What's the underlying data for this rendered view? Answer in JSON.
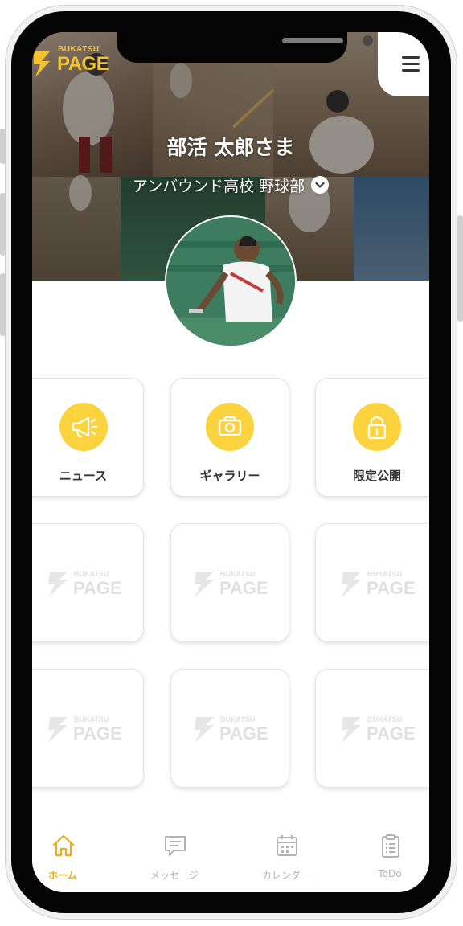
{
  "brand": {
    "logo_small": "BUKATSU",
    "logo_big": "PAGE",
    "accent_color": "#fbd33f",
    "brand_color": "#f2c230"
  },
  "header": {
    "user_name": "部活 太郎さま",
    "team_name": "アンバウンド高校 野球部",
    "team_dropdown_icon": "chevron-down-icon",
    "menu_icon": "hamburger-menu-icon"
  },
  "menu_tiles": [
    {
      "label": "ニュース",
      "icon": "megaphone-icon"
    },
    {
      "label": "ギャラリー",
      "icon": "camera-icon"
    },
    {
      "label": "限定公開",
      "icon": "lock-icon"
    }
  ],
  "placeholder_tiles": {
    "logo_small": "BUKATSU",
    "logo_big": "PAGE"
  },
  "tab_bar": {
    "active_color": "#f0ad1a",
    "items": [
      {
        "label": "ホーム",
        "icon": "home-icon",
        "active": true
      },
      {
        "label": "メッセージ",
        "icon": "message-icon",
        "active": false
      },
      {
        "label": "カレンダー",
        "icon": "calendar-icon",
        "active": false
      },
      {
        "label": "ToDo",
        "icon": "clipboard-icon",
        "active": false
      }
    ]
  }
}
